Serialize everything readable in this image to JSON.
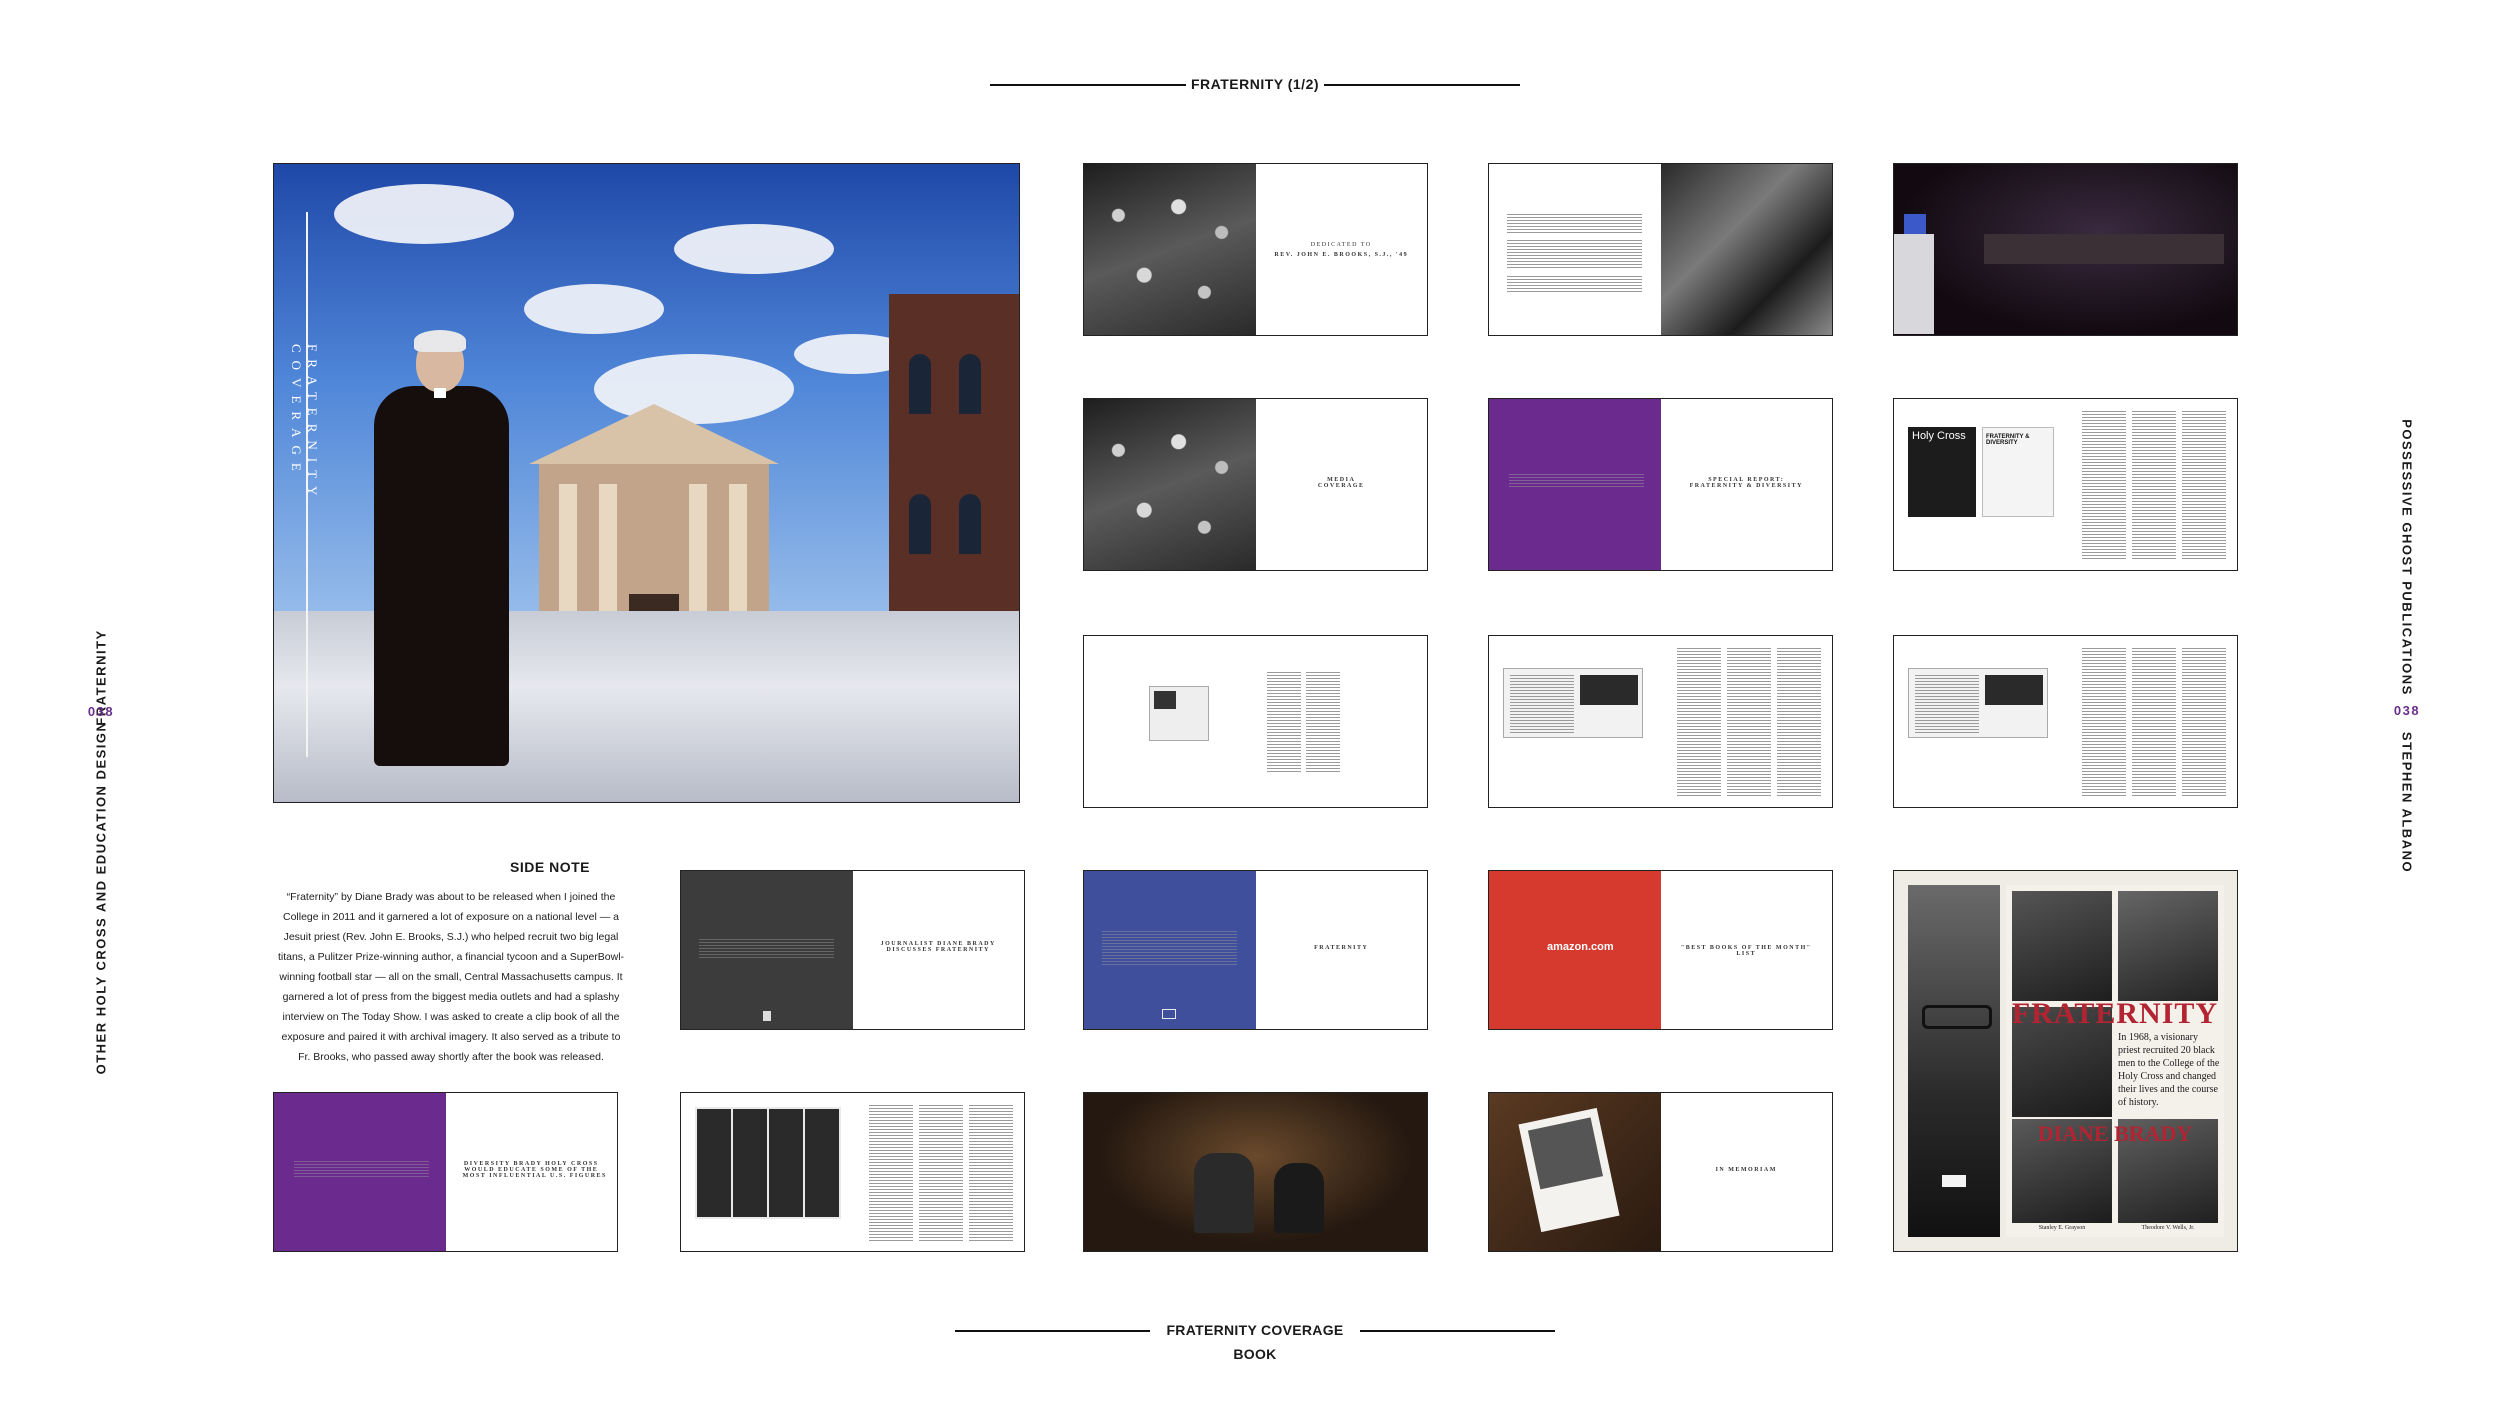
{
  "header": {
    "title": "FRATERNITY (1/2)"
  },
  "footer": {
    "title": "FRATERNITY COVERAGE BOOK"
  },
  "left_margin": {
    "section": "FRATERNITY",
    "page_number": "038",
    "project": "OTHER HOLY CROSS AND EDUCATION DESIGN"
  },
  "right_margin": {
    "publisher": "POSSESSIVE GHOST PUBLICATIONS",
    "page_number": "038",
    "author": "STEPHEN ALBANO"
  },
  "hero": {
    "vertical_title": "FRATERNITY COVERAGE"
  },
  "side_note": {
    "title": "SIDE NOTE",
    "body": "“Fraternity” by Diane Brady was about to be released when I joined the College in 2011 and it garnered a lot of exposure on a national level — a Jesuit priest (Rev. John E. Brooks, S.J.) who helped recruit two big legal titans, a Pulitzer Prize-winning author, a financial tycoon and a SuperBowl-winning football star — all on the small, Central Massachusetts campus. It garnered a lot of press from the biggest media outlets and had a splashy interview on The Today Show. I was asked to create a clip book of all the exposure and paired it with archival imagery. It also served as a tribute to Fr. Brooks, who passed away shortly after the book was released."
  },
  "spreads": {
    "dedication": {
      "line1": "DEDICATED TO",
      "line2": "REV. JOHN E. BROOKS, S.J., '49"
    },
    "media": {
      "title": "MEDIA\nCOVERAGE"
    },
    "special_report": {
      "title": "SPECIAL REPORT:\nFRATERNITY & DIVERSITY"
    },
    "journalist": {
      "title": "JOURNALIST DIANE BRADY\nDISCUSSES FRATERNITY"
    },
    "fraternity": {
      "title": "FRATERNITY"
    },
    "best_books": {
      "title": "\"BEST BOOKS OF THE MONTH\" LIST",
      "badge": "amazon.com"
    },
    "influential": {
      "title": "DIVERSITY BRADY HOLY CROSS\nWOULD EDUCATE SOME OF THE\nMOST INFLUENTIAL U.S. FIGURES"
    },
    "in_memoriam": {
      "title": "IN MEMORIAM"
    },
    "holycross_mag": {
      "masthead": "Holy Cross",
      "headline": "FRATERNITY & DIVERSITY"
    }
  },
  "book_cover": {
    "title": "FRATERNITY",
    "author": "DIANE BRADY",
    "blurb": "In 1968, a visionary priest recruited 20 black men to the College of the Holy Cross and changed their lives and the course of history.",
    "caption_left": "Stanley E. Grayson",
    "caption_right": "Theodore V. Wells, Jr."
  },
  "colors": {
    "purple": "#6a2a8e",
    "blue": "#3f4f9c",
    "red": "#d63a2f",
    "dark_gray": "#3c3c3c",
    "accent_text": "#6a2f8a"
  }
}
